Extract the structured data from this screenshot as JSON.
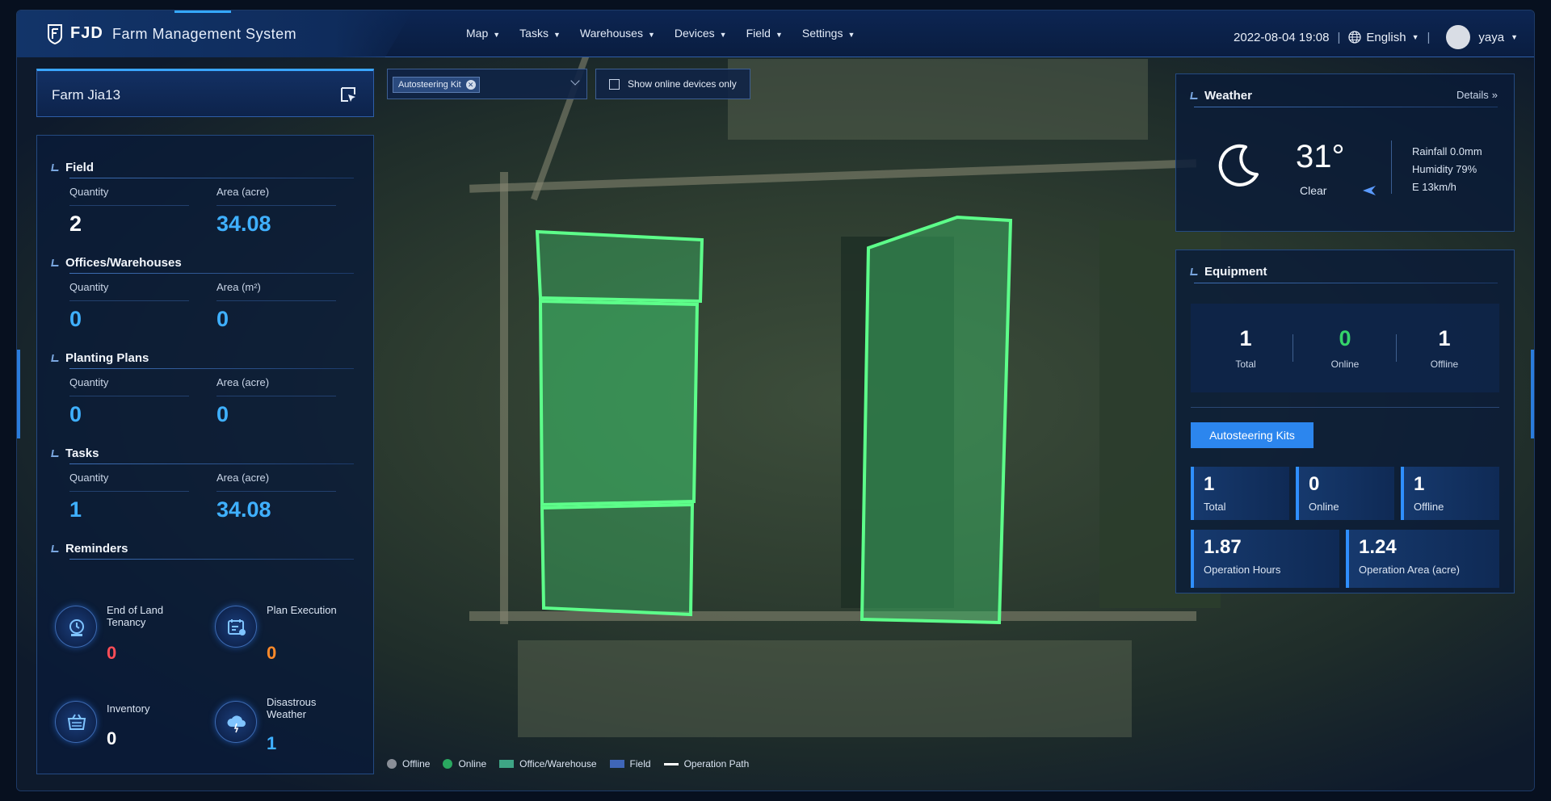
{
  "header": {
    "brand": "FJD",
    "subtitle": "Farm Management System",
    "nav": [
      "Map",
      "Tasks",
      "Warehouses",
      "Devices",
      "Field",
      "Settings"
    ],
    "datetime": "2022-08-04 19:08",
    "language": "English",
    "user": "yaya"
  },
  "farm": {
    "name": "Farm Jia13"
  },
  "stats": {
    "field": {
      "title": "Field",
      "qty_label": "Quantity",
      "area_label": "Area (acre)",
      "qty": "2",
      "area": "34.08"
    },
    "offices": {
      "title": "Offices/Warehouses",
      "qty_label": "Quantity",
      "area_label": "Area (m²)",
      "qty": "0",
      "area": "0"
    },
    "plans": {
      "title": "Planting Plans",
      "qty_label": "Quantity",
      "area_label": "Area (acre)",
      "qty": "0",
      "area": "0"
    },
    "tasks": {
      "title": "Tasks",
      "qty_label": "Quantity",
      "area_label": "Area (acre)",
      "qty": "1",
      "area": "34.08"
    }
  },
  "reminders": {
    "title": "Reminders",
    "items": [
      {
        "label": "End of Land Tenancy",
        "value": "0",
        "icon": "tenancy-icon",
        "color": "#ff4d57"
      },
      {
        "label": "Plan Execution",
        "value": "0",
        "icon": "plan-icon",
        "color": "#ff8a2a"
      },
      {
        "label": "Inventory",
        "value": "0",
        "icon": "inventory-icon",
        "color": "#ffffff"
      },
      {
        "label": "Disastrous Weather",
        "value": "1",
        "icon": "weather-alert-icon",
        "color": "#3fb0ff"
      }
    ]
  },
  "filters": {
    "kit_tag": "Autosteering Kit",
    "online_only_label": "Show online devices only",
    "online_only_checked": false
  },
  "weather": {
    "title": "Weather",
    "details": "Details",
    "temperature": "31°",
    "condition": "Clear",
    "rainfall": "Rainfall 0.0mm",
    "humidity": "Humidity 79%",
    "wind": "E 13km/h",
    "icon": "moon-icon"
  },
  "equipment": {
    "title": "Equipment",
    "total": "1",
    "total_label": "Total",
    "online": "0",
    "online_label": "Online",
    "offline": "1",
    "offline_label": "Offline",
    "kits_button": "Autosteering Kits",
    "kits": {
      "total": "1",
      "total_label": "Total",
      "online": "0",
      "online_label": "Online",
      "offline": "1",
      "offline_label": "Offline",
      "hours": "1.87",
      "hours_label": "Operation Hours",
      "area": "1.24",
      "area_label": "Operation Area (acre)"
    }
  },
  "legend": [
    {
      "label": "Offline",
      "color": "#8a8f98"
    },
    {
      "label": "Online",
      "color": "#2aa860"
    },
    {
      "label": "Office/Warehouse",
      "color": "#3ea585"
    },
    {
      "label": "Field",
      "color": "#3f66b8"
    },
    {
      "label": "Operation Path",
      "color": "#ffffff"
    }
  ],
  "colors": {
    "accent": "#2c86ee",
    "field_fill": "#3cb665",
    "field_stroke": "#5dff8a"
  }
}
